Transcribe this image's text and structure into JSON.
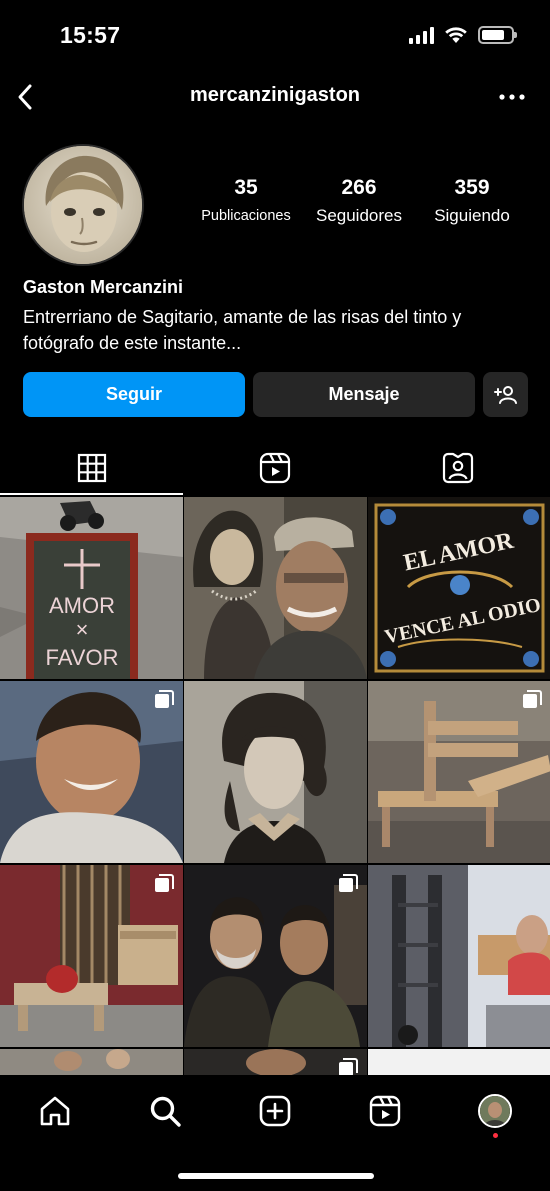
{
  "status_bar": {
    "time": "15:57",
    "battery_level": 0.8
  },
  "header": {
    "username": "mercanzinigaston",
    "back_icon": "chevron-left-icon",
    "more_icon": "more-horizontal-icon"
  },
  "profile": {
    "display_name": "Gaston Mercanzini",
    "bio_line1": "Entrerriano de Sagitario, amante de las risas del tinto y",
    "bio_line2": "fotógrafo de este instante...",
    "stats": [
      {
        "value": "35",
        "label": "Publicaciones"
      },
      {
        "value": "266",
        "label": "Seguidores"
      },
      {
        "value": "359",
        "label": "Siguiendo"
      }
    ]
  },
  "actions": {
    "follow": "Seguir",
    "message": "Mensaje",
    "suggest_icon": "add-person-icon"
  },
  "tabs": [
    {
      "icon": "grid-icon",
      "active": true
    },
    {
      "icon": "reels-icon",
      "active": false
    },
    {
      "icon": "tagged-icon",
      "active": false
    }
  ],
  "grid": {
    "post_texts": {
      "sign_line1": "AMOR",
      "sign_line2": "×",
      "sign_line3": "FAVOR",
      "art_line1": "EL AMOR",
      "art_line2": "VENCE AL ODIO"
    }
  },
  "bottom_nav": [
    {
      "icon": "home-icon"
    },
    {
      "icon": "search-icon"
    },
    {
      "icon": "create-icon"
    },
    {
      "icon": "reels-icon"
    },
    {
      "icon": "profile-avatar-icon"
    }
  ],
  "colors": {
    "accent": "#0095f6",
    "secondary_button": "#262626",
    "background": "#000000",
    "notification_dot": "#ff3040"
  }
}
